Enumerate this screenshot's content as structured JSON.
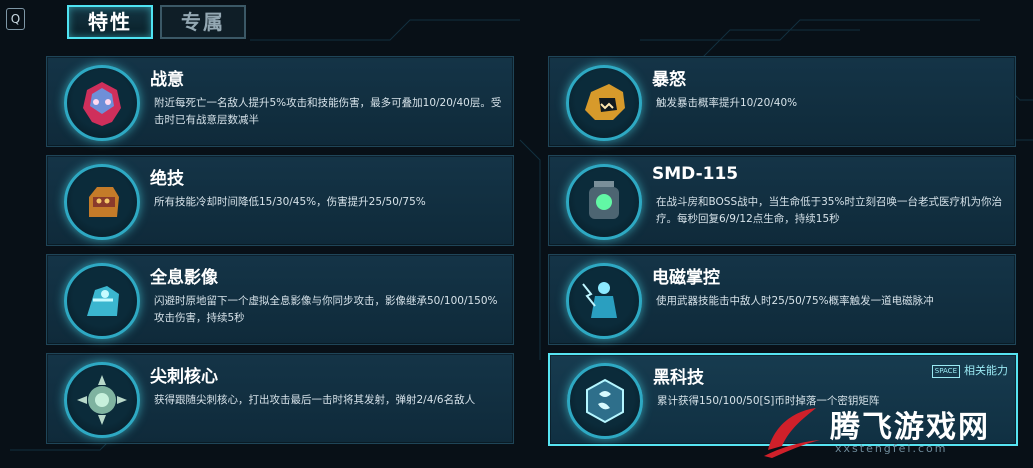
{
  "header": {
    "hotkey": "Q",
    "tabs": [
      {
        "label": "特性",
        "active": true
      },
      {
        "label": "专属",
        "active": false
      }
    ]
  },
  "traits": [
    {
      "name": "战意",
      "icon": "helmet-icon",
      "desc": "附近每死亡一名敌人提升5%攻击和技能伤害，最多可叠加10/20/40层。受击时已有战意层数减半"
    },
    {
      "name": "暴怒",
      "icon": "beast-head-icon",
      "desc": "触发暴击概率提升10/20/40%"
    },
    {
      "name": "绝技",
      "icon": "gauntlet-icon",
      "desc": "所有技能冷却时间降低15/30/45%，伤害提升25/50/75%"
    },
    {
      "name": "SMD-115",
      "icon": "robot-icon",
      "desc": "在战斗房和BOSS战中，当生命低于35%时立刻召唤一台老式医疗机为你治疗。每秒回复6/9/12点生命，持续15秒"
    },
    {
      "name": "全息影像",
      "icon": "hologram-icon",
      "desc": "闪避时原地留下一个虚拟全息影像与你同步攻击，影像继承50/100/150%攻击伤害，持续5秒"
    },
    {
      "name": "电磁掌控",
      "icon": "electric-figure-icon",
      "desc": "使用武器技能击中敌人时25/50/75%概率触发一道电磁脉冲"
    },
    {
      "name": "尖刺核心",
      "icon": "spike-core-icon",
      "desc": "获得跟随尖刺核心，打出攻击最后一击时将其发射，弹射2/4/6名敌人"
    },
    {
      "name": "黑科技",
      "icon": "hex-tech-icon",
      "desc": "累计获得150/100/50[S]币时掉落一个密钥矩阵"
    }
  ],
  "related": {
    "key": "SPACE",
    "label": "相关能力"
  },
  "watermark": {
    "text": "腾飞游戏网",
    "url": "xxstengfei.com"
  },
  "colors": {
    "accent": "#4fe3f2",
    "card_bg": "#143447",
    "page_bg": "#081017"
  }
}
